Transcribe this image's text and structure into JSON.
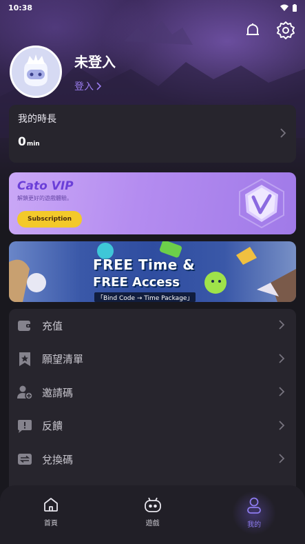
{
  "status_bar": {
    "time": "10:38"
  },
  "header": {
    "notification_icon": "bell-icon",
    "settings_icon": "gear-icon"
  },
  "profile": {
    "username": "未登入",
    "login_label": "登入"
  },
  "time_card": {
    "title": "我的時長",
    "value": "0",
    "unit": "min"
  },
  "vip": {
    "title": "Cato VIP",
    "subtitle": "解鎖更好的遊戲體驗。",
    "button_label": "Subscription"
  },
  "promo": {
    "line1": "FREE Time &",
    "line2": "FREE Access",
    "code_text": "「Bind Code → Time Package」"
  },
  "menu": {
    "items": [
      {
        "label": "充值",
        "icon": "wallet-icon"
      },
      {
        "label": "願望清單",
        "icon": "bookmark-star-icon"
      },
      {
        "label": "邀請碼",
        "icon": "add-user-icon"
      },
      {
        "label": "反饋",
        "icon": "feedback-icon"
      },
      {
        "label": "兌換碼",
        "icon": "exchange-icon"
      }
    ]
  },
  "tabs": [
    {
      "label": "首頁",
      "icon": "home-icon",
      "active": false
    },
    {
      "label": "遊戲",
      "icon": "gamepad-icon",
      "active": false
    },
    {
      "label": "我的",
      "icon": "profile-icon",
      "active": true
    }
  ],
  "colors": {
    "accent": "#9b7df0",
    "card_bg": "#27252d",
    "page_bg": "#19181e",
    "vip_button": "#f3c92a"
  }
}
